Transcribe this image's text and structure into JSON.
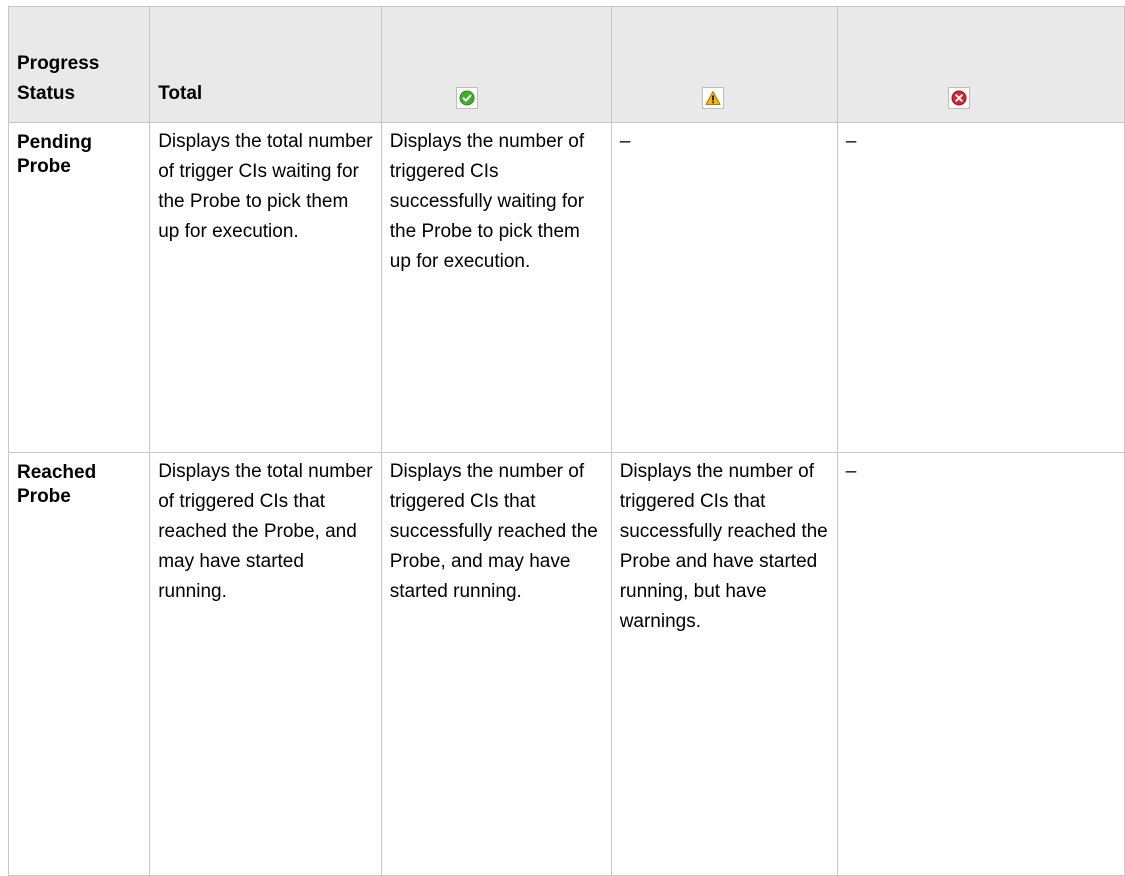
{
  "table": {
    "headers": {
      "progress_status": "Progress Status",
      "total": "Total",
      "success_icon": "success-check-icon",
      "warning_icon": "warning-triangle-icon",
      "error_icon": "error-x-icon"
    },
    "rows": [
      {
        "status": "Pending Probe",
        "total": "Displays the total number of trigger CIs waiting for the Probe to pick them up for execution.",
        "success": "Displays the number of triggered CIs successfully waiting for the Probe to pick them up for execution.",
        "warning": "–",
        "error": "–"
      },
      {
        "status": "Reached Probe",
        "total": "Displays the total number of triggered CIs that reached the Probe, and may have started running.",
        "success": "Displays the number of triggered CIs that successfully reached the Probe, and may have started running.",
        "warning": "Displays the number of triggered CIs that successfully reached the Probe and have started running, but have warnings.",
        "error": "–"
      }
    ],
    "colors": {
      "header_bg": "#e9e9e9",
      "border": "#c8c8c8",
      "success": "#3fae2a",
      "warning": "#f2b800",
      "error": "#d9232e"
    }
  }
}
